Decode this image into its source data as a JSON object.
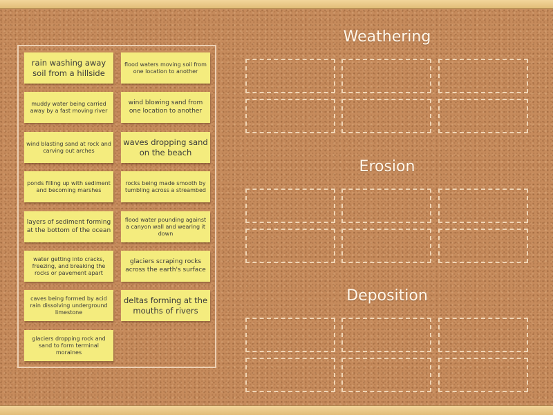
{
  "activity": {
    "type": "group sort",
    "cards": [
      "rain washing away soil from a hillside",
      "flood waters moving soil from one location to another",
      "muddy water being carried away by a fast moving river",
      "wind blowing sand from one location to another",
      "wind blasting sand at rock and carving out arches",
      "waves dropping sand on the beach",
      "ponds filling up with sediment and becoming marshes",
      "rocks being made smooth by tumbling across a streambed",
      "layers of sediment forming at the bottom of the ocean",
      "flood water pounding against a canyon wall and wearing it down",
      "water getting into cracks, freezing, and breaking the rocks or pavement apart",
      "glaciers scraping rocks across the earth's surface",
      "caves being formed by acid rain dissolving underground limestone",
      "deltas forming at the mouths of rivers",
      "glaciers dropping rock and sand to form terminal moraines"
    ],
    "groups": [
      {
        "title": "Weathering",
        "slots": 6
      },
      {
        "title": "Erosion",
        "slots": 6
      },
      {
        "title": "Deposition",
        "slots": 6
      }
    ]
  },
  "colors": {
    "card": "#f4ec7e",
    "cork": "#c68b5c",
    "frame": "#e9c98a",
    "heading": "#fff7ea",
    "slot_border": "#f0d5b5"
  }
}
